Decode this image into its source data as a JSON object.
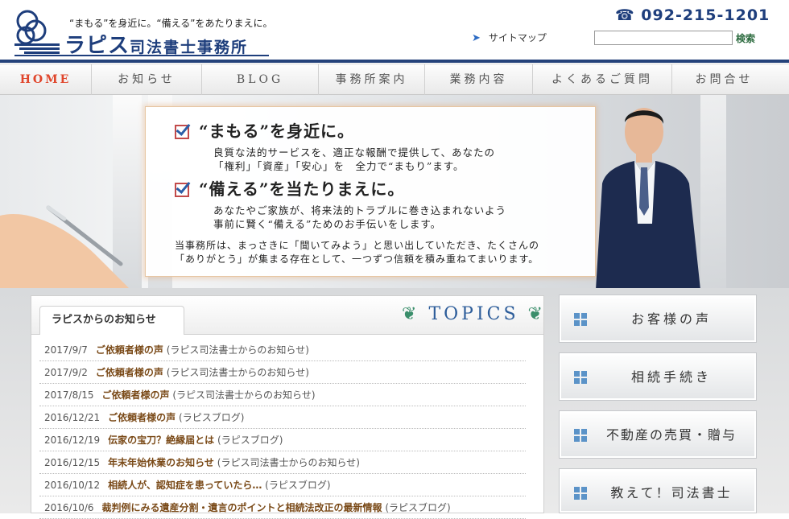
{
  "header": {
    "tagline": "“まもる”を身近に。“備える”をあたりまえに。",
    "logo_main": "ラピス",
    "logo_sub": "司法書士事務所",
    "phone": "☎ 092-215-1201",
    "sitemap": "サイトマップ",
    "search_placeholder": "",
    "search_button": "検索"
  },
  "nav": [
    {
      "label": "HOME"
    },
    {
      "label": "お知らせ"
    },
    {
      "label": "BLOG"
    },
    {
      "label": "事務所案内"
    },
    {
      "label": "業務内容"
    },
    {
      "label": "よくあるご質問"
    },
    {
      "label": "お問合せ"
    }
  ],
  "hero": {
    "heading1": "“まもる”を身近に。",
    "text1a": "良質な法的サービスを、適正な報酬で提供して、あなたの",
    "text1b": "「権利」「資産」「安心」を　全力で“まもり”ます。",
    "heading2": "“備える”を当たりまえに。",
    "text2a": "あなたやご家族が、将来法的トラブルに巻き込まれないよう",
    "text2b": "事前に賢く“備える”ためのお手伝いをします。",
    "text3a": "当事務所は、まっさきに「聞いてみよう」と思い出していただき、たくさんの",
    "text3b": "「ありがとう」が集まる存在として、一つずつ信頼を積み重ねてまいります。"
  },
  "topics": {
    "tab": "ラピスからのお知らせ",
    "title": "TOPICS",
    "news": [
      {
        "date": "2017/9/7",
        "title": "ご依頼者様の声",
        "category": "(ラピス司法書士からのお知らせ)"
      },
      {
        "date": "2017/9/2",
        "title": "ご依頼者様の声",
        "category": "(ラピス司法書士からのお知らせ)"
      },
      {
        "date": "2017/8/15",
        "title": "ご依頼者様の声",
        "category": "(ラピス司法書士からのお知らせ)"
      },
      {
        "date": "2016/12/21",
        "title": "ご依頼者様の声",
        "category": "(ラピスブログ)"
      },
      {
        "date": "2016/12/19",
        "title": "伝家の宝刀？絶縁届とは",
        "category": "(ラピスブログ)"
      },
      {
        "date": "2016/12/15",
        "title": "年末年始休業のお知らせ",
        "category": "(ラピス司法書士からのお知らせ)"
      },
      {
        "date": "2016/10/12",
        "title": "相続人が、認知症を患っていたら…",
        "category": "(ラピスブログ)"
      },
      {
        "date": "2016/10/6",
        "title": "裁判例にみる遺産分割・遺言のポイントと相続法改正の最新情報",
        "category": "(ラピスブログ)"
      }
    ]
  },
  "sidebar": [
    {
      "label": "お客様の声"
    },
    {
      "label": "相続手続き"
    },
    {
      "label": "不動産の売買・贈与"
    },
    {
      "label": "教えて！司法書士"
    }
  ]
}
